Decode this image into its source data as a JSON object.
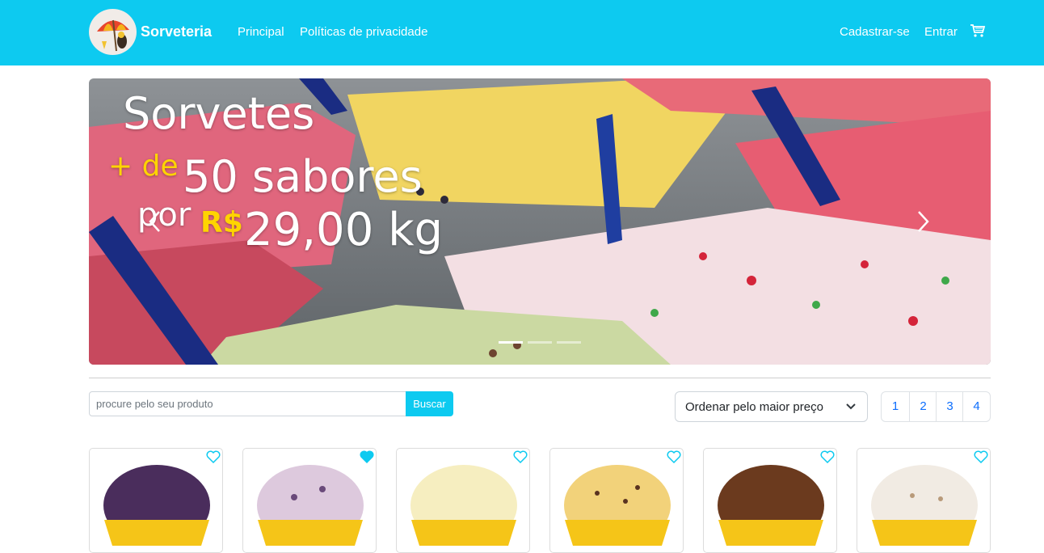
{
  "navbar": {
    "brand": "Sorveteria",
    "links": [
      "Principal",
      "Políticas de privacidade"
    ],
    "signup": "Cadastrar-se",
    "login": "Entrar",
    "cart_icon": "cart-icon",
    "color": "#0dcaf0"
  },
  "carousel": {
    "line1": "Sorvetes",
    "line2_prefix": "+ de",
    "line2_main": "50 sabores",
    "line3_prefix": "por",
    "line3_currency": "R$",
    "line3_price": "29,00 kg",
    "highlight_color": "#ffd400",
    "active_indicator": 1,
    "indicator_count": 3
  },
  "search": {
    "placeholder": "procure pelo seu produto",
    "value": "",
    "button": "Buscar"
  },
  "sort": {
    "selected": "Ordenar pelo maior preço"
  },
  "pagination": {
    "pages": [
      "1",
      "2",
      "3",
      "4"
    ]
  },
  "products": [
    {
      "favorited": false,
      "flavor_color": "#4a2d5c"
    },
    {
      "favorited": true,
      "flavor_color": "#ddc9dd"
    },
    {
      "favorited": false,
      "flavor_color": "#f6eec0"
    },
    {
      "favorited": false,
      "flavor_color": "#f2d27a"
    },
    {
      "favorited": false,
      "flavor_color": "#6b3a1e"
    },
    {
      "favorited": false,
      "flavor_color": "#f1ebe3"
    }
  ]
}
